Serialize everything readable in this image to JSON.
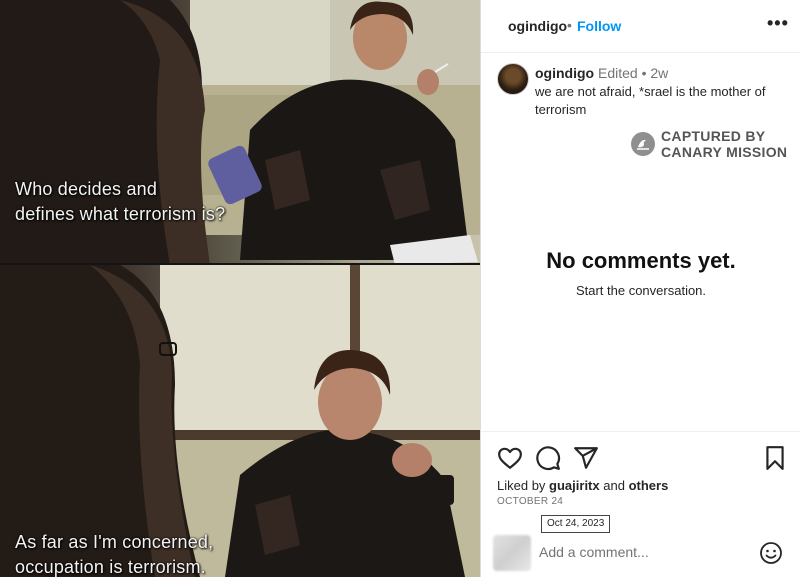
{
  "media": {
    "subtitle_top_line1": "Who decides and",
    "subtitle_top_line2": "defines what terrorism is?",
    "subtitle_bottom_line1": "As far as I'm concerned,",
    "subtitle_bottom_line2": "occupation is terrorism."
  },
  "header": {
    "username": "ogindigo",
    "separator": "•",
    "follow_label": "Follow",
    "more_label": "•••"
  },
  "caption": {
    "username": "ogindigo",
    "edited": "Edited",
    "separator": "•",
    "age": "2w",
    "text": "we are not afraid, *srael is the mother of terrorism"
  },
  "watermark": {
    "line1": "CAPTURED BY",
    "line2": "CANARY MISSION"
  },
  "comments": {
    "empty_title": "No comments yet.",
    "empty_subtitle": "Start the conversation."
  },
  "actions": {
    "like_icon": "heart-icon",
    "comment_icon": "comment-bubble-icon",
    "share_icon": "paper-plane-icon",
    "save_icon": "bookmark-icon"
  },
  "likes": {
    "prefix": "Liked by",
    "user": "guajiritx",
    "conjunction": "and",
    "others": "others"
  },
  "post_date": "OCTOBER 24",
  "tooltip": "Oct 24, 2023",
  "comment_box": {
    "placeholder": "Add a comment...",
    "emoji_icon": "smiley-icon"
  },
  "colors": {
    "accent": "#0095f6",
    "text": "#262626",
    "muted": "#737373"
  }
}
